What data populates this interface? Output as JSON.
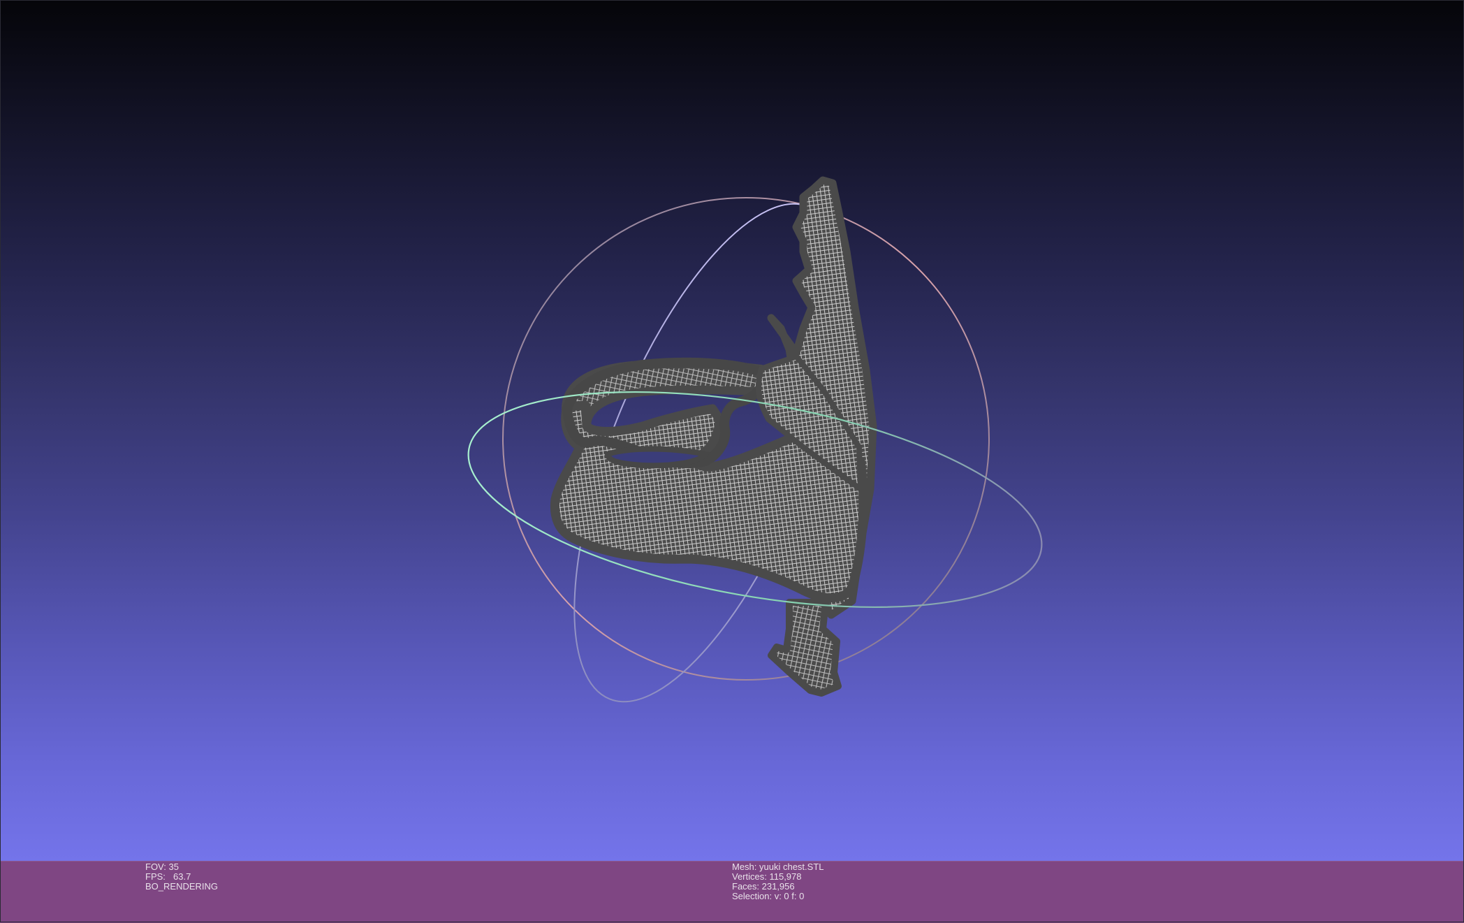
{
  "viewport": {
    "background_top": "#050509",
    "background_bottom": "#7474ea",
    "mesh_color": "#4a4a4a",
    "wire_color": "#c9c9c9",
    "trackball_colors": {
      "red_ring": "#c99aa6",
      "green_ring": "#8ed4b0",
      "blue_ring": "#b4aee8"
    }
  },
  "infobar": {
    "background": "#7f4683",
    "fov_label": "FOV: 35",
    "fps_label": "FPS:",
    "fps_value": "63.7",
    "render_mode": "BO_RENDERING",
    "mesh_name": "Mesh: yuuki chest.STL",
    "vertices": "Vertices: 115,978",
    "faces": "Faces: 231,956",
    "selection": "Selection: v: 0 f: 0"
  }
}
